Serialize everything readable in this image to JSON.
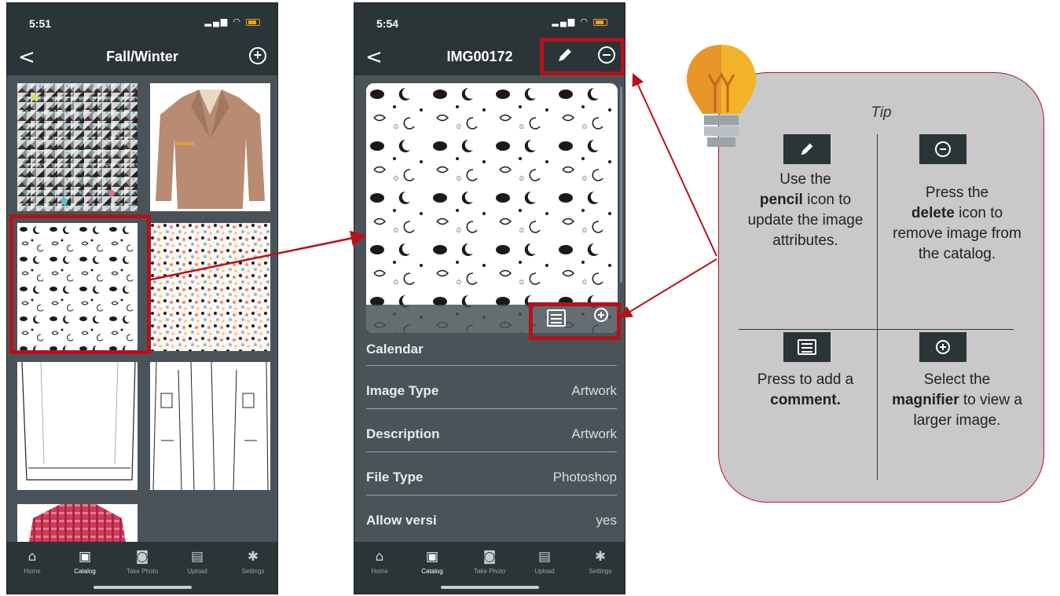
{
  "phone1": {
    "status": {
      "time": "5:51"
    },
    "nav": {
      "back": "<",
      "title": "Fall/Winter",
      "add": "+"
    }
  },
  "phone2": {
    "status": {
      "time": "5:54"
    },
    "nav": {
      "back": "<",
      "title": "IMG00172"
    },
    "attributes": [
      {
        "label": "Calendar",
        "value": ""
      },
      {
        "label": "Image Type",
        "value": "Artwork"
      },
      {
        "label": "Description",
        "value": "Artwork"
      },
      {
        "label": "File Type",
        "value": "Photoshop"
      },
      {
        "label": "Allow versi",
        "value": "yes"
      }
    ]
  },
  "tabbar": {
    "items": [
      {
        "label": "Home",
        "icon": "home-icon"
      },
      {
        "label": "Catalog",
        "icon": "catalog-icon"
      },
      {
        "label": "Take Photo",
        "icon": "camera-icon"
      },
      {
        "label": "Upload",
        "icon": "upload-icon"
      },
      {
        "label": "Settings",
        "icon": "gear-icon"
      }
    ]
  },
  "tip": {
    "title": "Tip",
    "pencil_pre": "Use the",
    "pencil_bold": "pencil",
    "pencil_post": "icon to update the image attributes.",
    "delete_pre": "Press the",
    "delete_bold": "delete",
    "delete_post": "icon to remove image from the catalog.",
    "comment_pre": "Press to add a",
    "comment_bold": "comment.",
    "magnifier_pre": "Select the",
    "magnifier_bold": "magnifier",
    "magnifier_post": "to view a larger image."
  },
  "colors": {
    "accent_red": "#b5121b",
    "phone_bg": "#2b3437",
    "panel_bg": "#c9c9c9"
  }
}
